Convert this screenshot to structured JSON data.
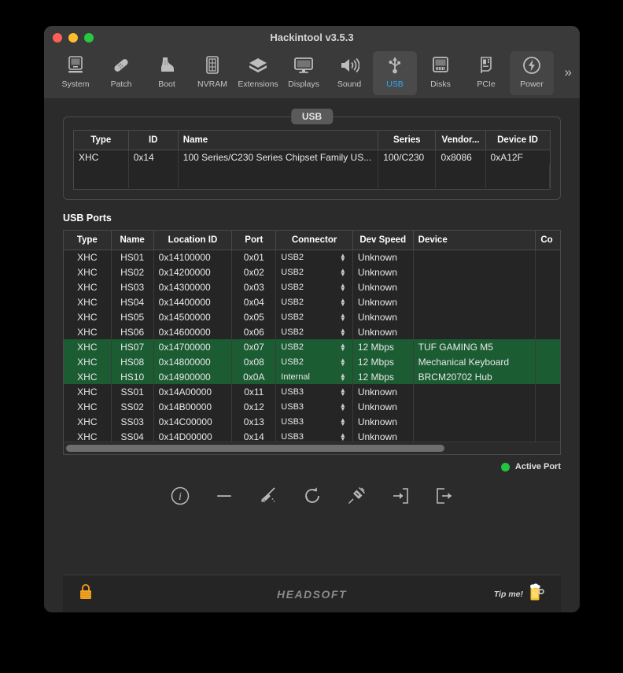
{
  "window": {
    "title": "Hackintool v3.5.3",
    "controls": {
      "close": "close",
      "minimize": "minimize",
      "zoom": "zoom"
    }
  },
  "toolbar": {
    "overflow": "»",
    "items": [
      {
        "label": "System",
        "icon": "computer-icon",
        "selected": false
      },
      {
        "label": "Patch",
        "icon": "bandage-icon",
        "selected": false
      },
      {
        "label": "Boot",
        "icon": "boot-icon",
        "selected": false
      },
      {
        "label": "NVRAM",
        "icon": "memory-icon",
        "selected": false
      },
      {
        "label": "Extensions",
        "icon": "package-icon",
        "selected": false
      },
      {
        "label": "Displays",
        "icon": "monitor-icon",
        "selected": false
      },
      {
        "label": "Sound",
        "icon": "speaker-icon",
        "selected": false
      },
      {
        "label": "USB",
        "icon": "usb-icon",
        "selected": true
      },
      {
        "label": "Disks",
        "icon": "disk-icon",
        "selected": false
      },
      {
        "label": "PCIe",
        "icon": "pcie-card-icon",
        "selected": false
      },
      {
        "label": "Power",
        "icon": "power-bolt-icon",
        "selected": false
      }
    ]
  },
  "tab": {
    "label": "USB"
  },
  "controllers_table": {
    "columns": [
      "Type",
      "ID",
      "Name",
      "Series",
      "Vendor...",
      "Device ID"
    ],
    "rows": [
      {
        "type": "XHC",
        "id": "0x14",
        "name": "100 Series/C230 Series Chipset Family US...",
        "series": "100/C230",
        "vendor": "0x8086",
        "device_id": "0xA12F"
      }
    ]
  },
  "ports_section": {
    "title": "USB Ports",
    "columns": [
      "Type",
      "Name",
      "Location ID",
      "Port",
      "Connector",
      "Dev Speed",
      "Device",
      "Co"
    ],
    "rows": [
      {
        "type": "XHC",
        "name": "HS01",
        "location_id": "0x14100000",
        "port": "0x01",
        "connector": "USB2",
        "dev_speed": "Unknown",
        "device": "",
        "active": false
      },
      {
        "type": "XHC",
        "name": "HS02",
        "location_id": "0x14200000",
        "port": "0x02",
        "connector": "USB2",
        "dev_speed": "Unknown",
        "device": "",
        "active": false
      },
      {
        "type": "XHC",
        "name": "HS03",
        "location_id": "0x14300000",
        "port": "0x03",
        "connector": "USB2",
        "dev_speed": "Unknown",
        "device": "",
        "active": false
      },
      {
        "type": "XHC",
        "name": "HS04",
        "location_id": "0x14400000",
        "port": "0x04",
        "connector": "USB2",
        "dev_speed": "Unknown",
        "device": "",
        "active": false
      },
      {
        "type": "XHC",
        "name": "HS05",
        "location_id": "0x14500000",
        "port": "0x05",
        "connector": "USB2",
        "dev_speed": "Unknown",
        "device": "",
        "active": false
      },
      {
        "type": "XHC",
        "name": "HS06",
        "location_id": "0x14600000",
        "port": "0x06",
        "connector": "USB2",
        "dev_speed": "Unknown",
        "device": "",
        "active": false
      },
      {
        "type": "XHC",
        "name": "HS07",
        "location_id": "0x14700000",
        "port": "0x07",
        "connector": "USB2",
        "dev_speed": "12 Mbps",
        "device": "TUF GAMING M5",
        "active": true
      },
      {
        "type": "XHC",
        "name": "HS08",
        "location_id": "0x14800000",
        "port": "0x08",
        "connector": "USB2",
        "dev_speed": "12 Mbps",
        "device": "Mechanical Keyboard",
        "active": true
      },
      {
        "type": "XHC",
        "name": "HS10",
        "location_id": "0x14900000",
        "port": "0x0A",
        "connector": "Internal",
        "dev_speed": "12 Mbps",
        "device": "BRCM20702 Hub",
        "active": true
      },
      {
        "type": "XHC",
        "name": "SS01",
        "location_id": "0x14A00000",
        "port": "0x11",
        "connector": "USB3",
        "dev_speed": "Unknown",
        "device": "",
        "active": false
      },
      {
        "type": "XHC",
        "name": "SS02",
        "location_id": "0x14B00000",
        "port": "0x12",
        "connector": "USB3",
        "dev_speed": "Unknown",
        "device": "",
        "active": false
      },
      {
        "type": "XHC",
        "name": "SS03",
        "location_id": "0x14C00000",
        "port": "0x13",
        "connector": "USB3",
        "dev_speed": "Unknown",
        "device": "",
        "active": false
      },
      {
        "type": "XHC",
        "name": "SS04",
        "location_id": "0x14D00000",
        "port": "0x14",
        "connector": "USB3",
        "dev_speed": "Unknown",
        "device": "",
        "active": false
      }
    ]
  },
  "legend": {
    "label": "Active Port",
    "color": "#22c540"
  },
  "actions": [
    {
      "name": "info-icon",
      "title": "Info"
    },
    {
      "name": "minus-icon",
      "title": "Remove"
    },
    {
      "name": "broom-icon",
      "title": "Clean"
    },
    {
      "name": "refresh-icon",
      "title": "Refresh"
    },
    {
      "name": "syringe-icon",
      "title": "Inject"
    },
    {
      "name": "import-icon",
      "title": "Import"
    },
    {
      "name": "export-icon",
      "title": "Export"
    }
  ],
  "footer": {
    "lock_icon": "padlock-icon",
    "logo": "HEADSOFT",
    "tip_label": "Tip me!",
    "tip_icon": "beer-mug-icon"
  }
}
